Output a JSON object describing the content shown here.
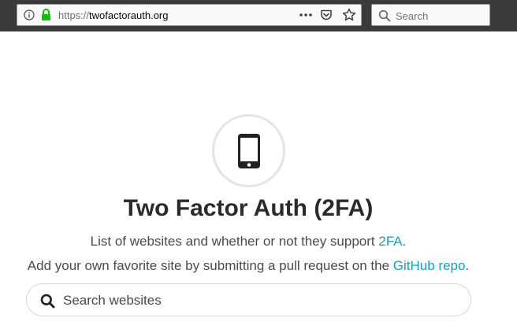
{
  "browser": {
    "url_scheme": "https://",
    "url_host": "twofactorauth.org",
    "search_placeholder": "Search"
  },
  "hero": {
    "title": "Two Factor Auth (2FA)",
    "subtitle_prefix": "List of websites and whether or not they support ",
    "subtitle_link": "2FA",
    "subtitle_suffix": ".",
    "subtitle2_prefix": "Add your own favorite site by submitting a pull request on the ",
    "subtitle2_link": "GitHub repo",
    "subtitle2_suffix": "."
  },
  "site_search": {
    "placeholder": "Search websites"
  },
  "colors": {
    "link": "#1a9cb5",
    "lock": "#12bc00",
    "toolbar": "#3a3a3a"
  }
}
